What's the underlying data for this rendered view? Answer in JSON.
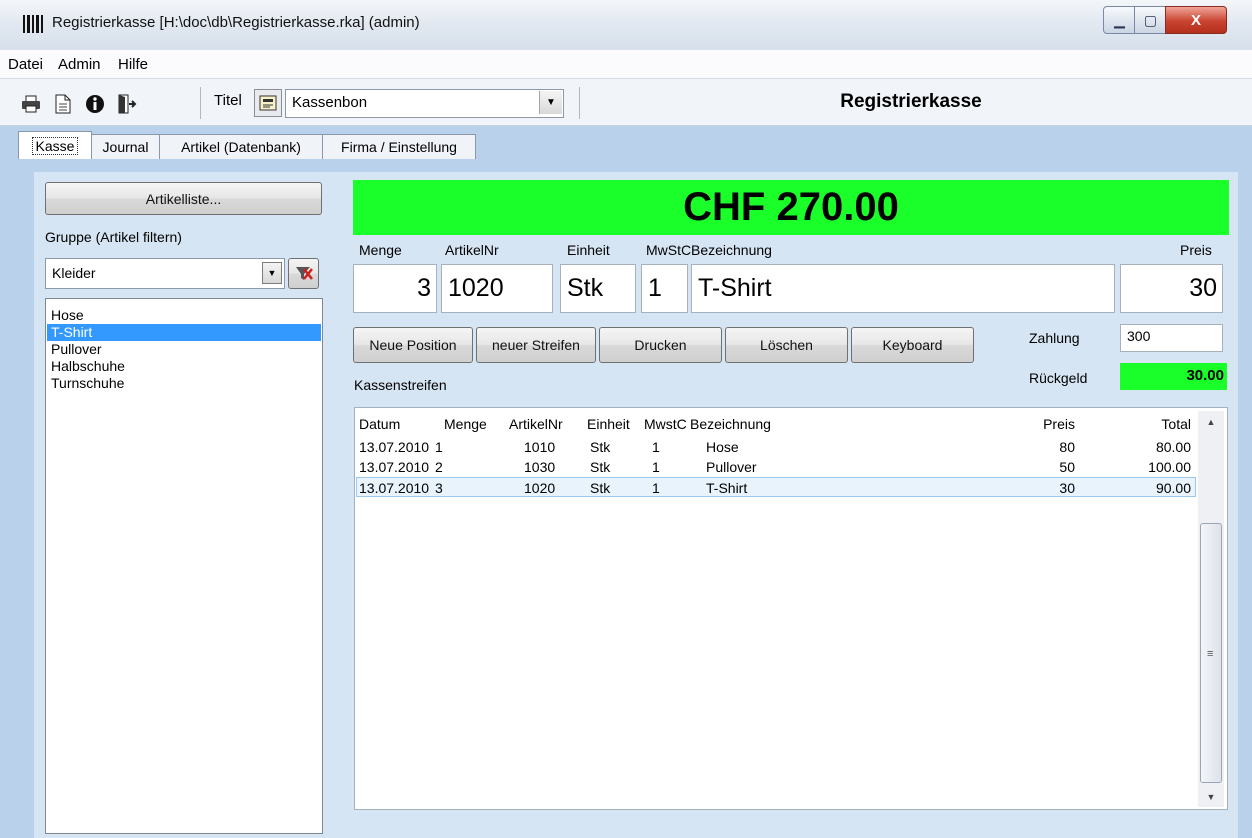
{
  "window": {
    "title": "Registrierkasse [H:\\doc\\db\\Registrierkasse.rka] (admin)",
    "controls": {
      "minimize": "▁",
      "maximize": "▢",
      "close": "X"
    }
  },
  "menu": {
    "items": [
      "Datei",
      "Admin",
      "Hilfe"
    ]
  },
  "toolbar": {
    "icons": [
      "printer-icon",
      "document-icon",
      "info-icon",
      "exit-icon"
    ],
    "title_label": "Titel",
    "title_select_value": "Kassenbon",
    "heading": "Registrierkasse"
  },
  "tabs": [
    {
      "label": "Kasse",
      "active": true
    },
    {
      "label": "Journal",
      "active": false
    },
    {
      "label": "Artikel (Datenbank)",
      "active": false
    },
    {
      "label": "Firma / Einstellung",
      "active": false
    }
  ],
  "left": {
    "artikelliste_button": "Artikelliste...",
    "group_label": "Gruppe (Artikel filtern)",
    "group_value": "Kleider",
    "articles": [
      "Hose",
      "T-Shirt",
      "Pullover",
      "Halbschuhe",
      "Turnschuhe"
    ],
    "selected_article": "T-Shirt"
  },
  "total": {
    "display": "CHF 270.00",
    "color": "#1aff2a"
  },
  "entry": {
    "labels": {
      "menge": "Menge",
      "artikelnr": "ArtikelNr",
      "einheit": "Einheit",
      "mwstc": "MwStC",
      "bezeichnung": "Bezeichnung",
      "preis": "Preis"
    },
    "values": {
      "menge": "3",
      "artikelnr": "1020",
      "einheit": "Stk",
      "mwstc": "1",
      "bezeichnung": "T-Shirt",
      "preis": "30"
    }
  },
  "actions": {
    "neue_position": "Neue Position",
    "neuer_streifen": "neuer Streifen",
    "drucken": "Drucken",
    "loeschen": "Löschen",
    "keyboard": "Keyboard"
  },
  "payment": {
    "zahlung_label": "Zahlung",
    "zahlung_value": "300",
    "rueckgeld_label": "Rückgeld",
    "rueckgeld_value": "30.00"
  },
  "strip": {
    "label": "Kassenstreifen",
    "columns": {
      "datum": "Datum",
      "menge": "Menge",
      "artikelnr": "ArtikelNr",
      "einheit": "Einheit",
      "mwstc": "MwstC",
      "bezeichnung": "Bezeichnung",
      "preis": "Preis",
      "total": "Total"
    },
    "rows": [
      {
        "datum": "13.07.2010",
        "menge": "1",
        "artikelnr": "1010",
        "einheit": "Stk",
        "mwstc": "1",
        "bezeichnung": "Hose",
        "preis": "80",
        "total": "80.00",
        "selected": false
      },
      {
        "datum": "13.07.2010",
        "menge": "2",
        "artikelnr": "1030",
        "einheit": "Stk",
        "mwstc": "1",
        "bezeichnung": "Pullover",
        "preis": "50",
        "total": "100.00",
        "selected": false
      },
      {
        "datum": "13.07.2010",
        "menge": "3",
        "artikelnr": "1020",
        "einheit": "Stk",
        "mwstc": "1",
        "bezeichnung": "T-Shirt",
        "preis": "30",
        "total": "90.00",
        "selected": true
      }
    ]
  }
}
